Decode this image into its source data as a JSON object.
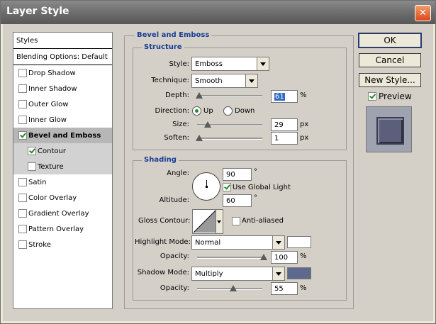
{
  "window": {
    "title": "Layer Style"
  },
  "styles_list": {
    "header": "Styles",
    "blending": "Blending Options: Default",
    "items": [
      {
        "label": "Drop Shadow",
        "checked": false
      },
      {
        "label": "Inner Shadow",
        "checked": false
      },
      {
        "label": "Outer Glow",
        "checked": false
      },
      {
        "label": "Inner Glow",
        "checked": false
      },
      {
        "label": "Bevel and Emboss",
        "checked": true
      },
      {
        "label": "Contour",
        "checked": true
      },
      {
        "label": "Texture",
        "checked": false
      },
      {
        "label": "Satin",
        "checked": false
      },
      {
        "label": "Color Overlay",
        "checked": false
      },
      {
        "label": "Gradient Overlay",
        "checked": false
      },
      {
        "label": "Pattern Overlay",
        "checked": false
      },
      {
        "label": "Stroke",
        "checked": false
      }
    ]
  },
  "bevel": {
    "group_title": "Bevel and Emboss",
    "structure_title": "Structure",
    "style_label": "Style:",
    "style_value": "Emboss",
    "technique_label": "Technique:",
    "technique_value": "Smooth",
    "depth_label": "Depth:",
    "depth_value": "61",
    "depth_unit": "%",
    "direction_label": "Direction:",
    "direction_up": "Up",
    "direction_down": "Down",
    "size_label": "Size:",
    "size_value": "29",
    "size_unit": "px",
    "soften_label": "Soften:",
    "soften_value": "1",
    "soften_unit": "px"
  },
  "shading": {
    "title": "Shading",
    "angle_label": "Angle:",
    "angle_value": "90",
    "angle_unit": "°",
    "global_light_label": "Use Global Light",
    "altitude_label": "Altitude:",
    "altitude_value": "60",
    "altitude_unit": "°",
    "gloss_label": "Gloss Contour:",
    "anti_aliased_label": "Anti-aliased",
    "highlight_mode_label": "Highlight Mode:",
    "highlight_mode_value": "Normal",
    "highlight_opacity_label": "Opacity:",
    "highlight_opacity_value": "100",
    "highlight_opacity_unit": "%",
    "shadow_mode_label": "Shadow Mode:",
    "shadow_mode_value": "Multiply",
    "shadow_opacity_label": "Opacity:",
    "shadow_opacity_value": "55",
    "shadow_opacity_unit": "%",
    "highlight_color": "#ffffff",
    "shadow_color": "#5d6a8d"
  },
  "buttons": {
    "ok": "OK",
    "cancel": "Cancel",
    "new_style": "New Style...",
    "preview": "Preview"
  }
}
